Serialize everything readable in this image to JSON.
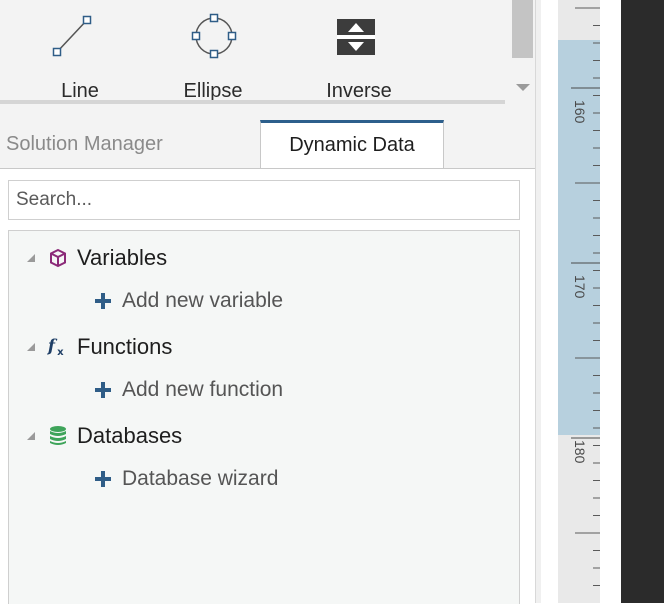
{
  "toolbar": {
    "tools": [
      {
        "label": "Line",
        "icon": "line-icon"
      },
      {
        "label": "Ellipse",
        "icon": "ellipse-icon"
      },
      {
        "label": "Inverse",
        "icon": "inverse-icon"
      }
    ]
  },
  "tabs": [
    {
      "label": "Solution Manager",
      "active": false
    },
    {
      "label": "Dynamic Data",
      "active": true
    }
  ],
  "search": {
    "placeholder": "Search..."
  },
  "tree": [
    {
      "label": "Variables",
      "icon": "cube-icon",
      "child": "Add new variable"
    },
    {
      "label": "Functions",
      "icon": "fx-icon",
      "child": "Add new function"
    },
    {
      "label": "Databases",
      "icon": "database-icon",
      "child": "Database wizard"
    }
  ],
  "ruler": {
    "labels": [
      "160",
      "170",
      "180"
    ]
  },
  "colors": {
    "tab_accent": "#2d5f8c",
    "plus": "#2f5d87",
    "variables_icon": "#8b2a78",
    "functions_icon": "#1f3f66",
    "database_icon": "#3ea45a"
  }
}
